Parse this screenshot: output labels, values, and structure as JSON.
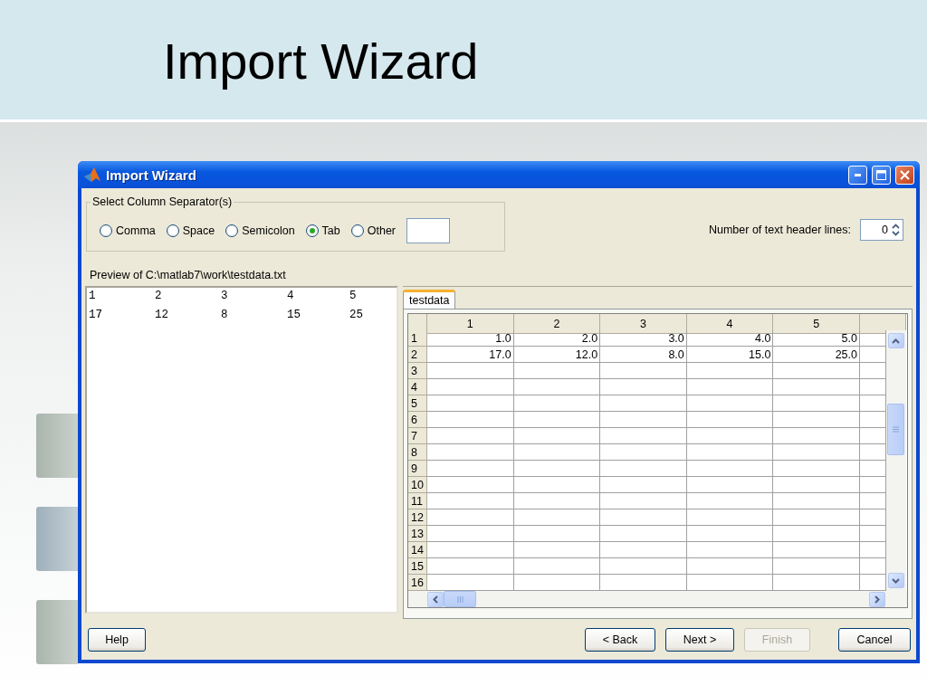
{
  "slide": {
    "title": "Import Wizard"
  },
  "window": {
    "title": "Import Wizard"
  },
  "separator_group": {
    "title": "Select Column Separator(s)",
    "options": [
      {
        "label": "Comma",
        "selected": false
      },
      {
        "label": "Space",
        "selected": false
      },
      {
        "label": "Semicolon",
        "selected": false
      },
      {
        "label": "Tab",
        "selected": true
      },
      {
        "label": "Other",
        "selected": false
      }
    ]
  },
  "header_lines": {
    "label": "Number of text header lines:",
    "value": "0"
  },
  "preview": {
    "title": "Preview of C:\\matlab7\\work\\testdata.txt",
    "lines": [
      [
        "1",
        "2",
        "3",
        "4",
        "5"
      ],
      [
        "17",
        "12",
        "8",
        "15",
        "25"
      ]
    ]
  },
  "tabs": [
    {
      "label": "testdata",
      "selected": true
    }
  ],
  "table": {
    "columns": [
      "1",
      "2",
      "3",
      "4",
      "5"
    ],
    "row_headers": [
      "1",
      "2",
      "3",
      "4",
      "5",
      "6",
      "7",
      "8",
      "9",
      "10",
      "11",
      "12",
      "13",
      "14",
      "15",
      "16"
    ],
    "rows": [
      [
        "1.0",
        "2.0",
        "3.0",
        "4.0",
        "5.0"
      ],
      [
        "17.0",
        "12.0",
        "8.0",
        "15.0",
        "25.0"
      ]
    ]
  },
  "buttons": [
    {
      "label": "Help",
      "disabled": false
    },
    {
      "label": "< Back",
      "disabled": false
    },
    {
      "label": "Next >",
      "disabled": false
    },
    {
      "label": "Finish",
      "disabled": true
    },
    {
      "label": "Cancel",
      "disabled": false
    }
  ]
}
